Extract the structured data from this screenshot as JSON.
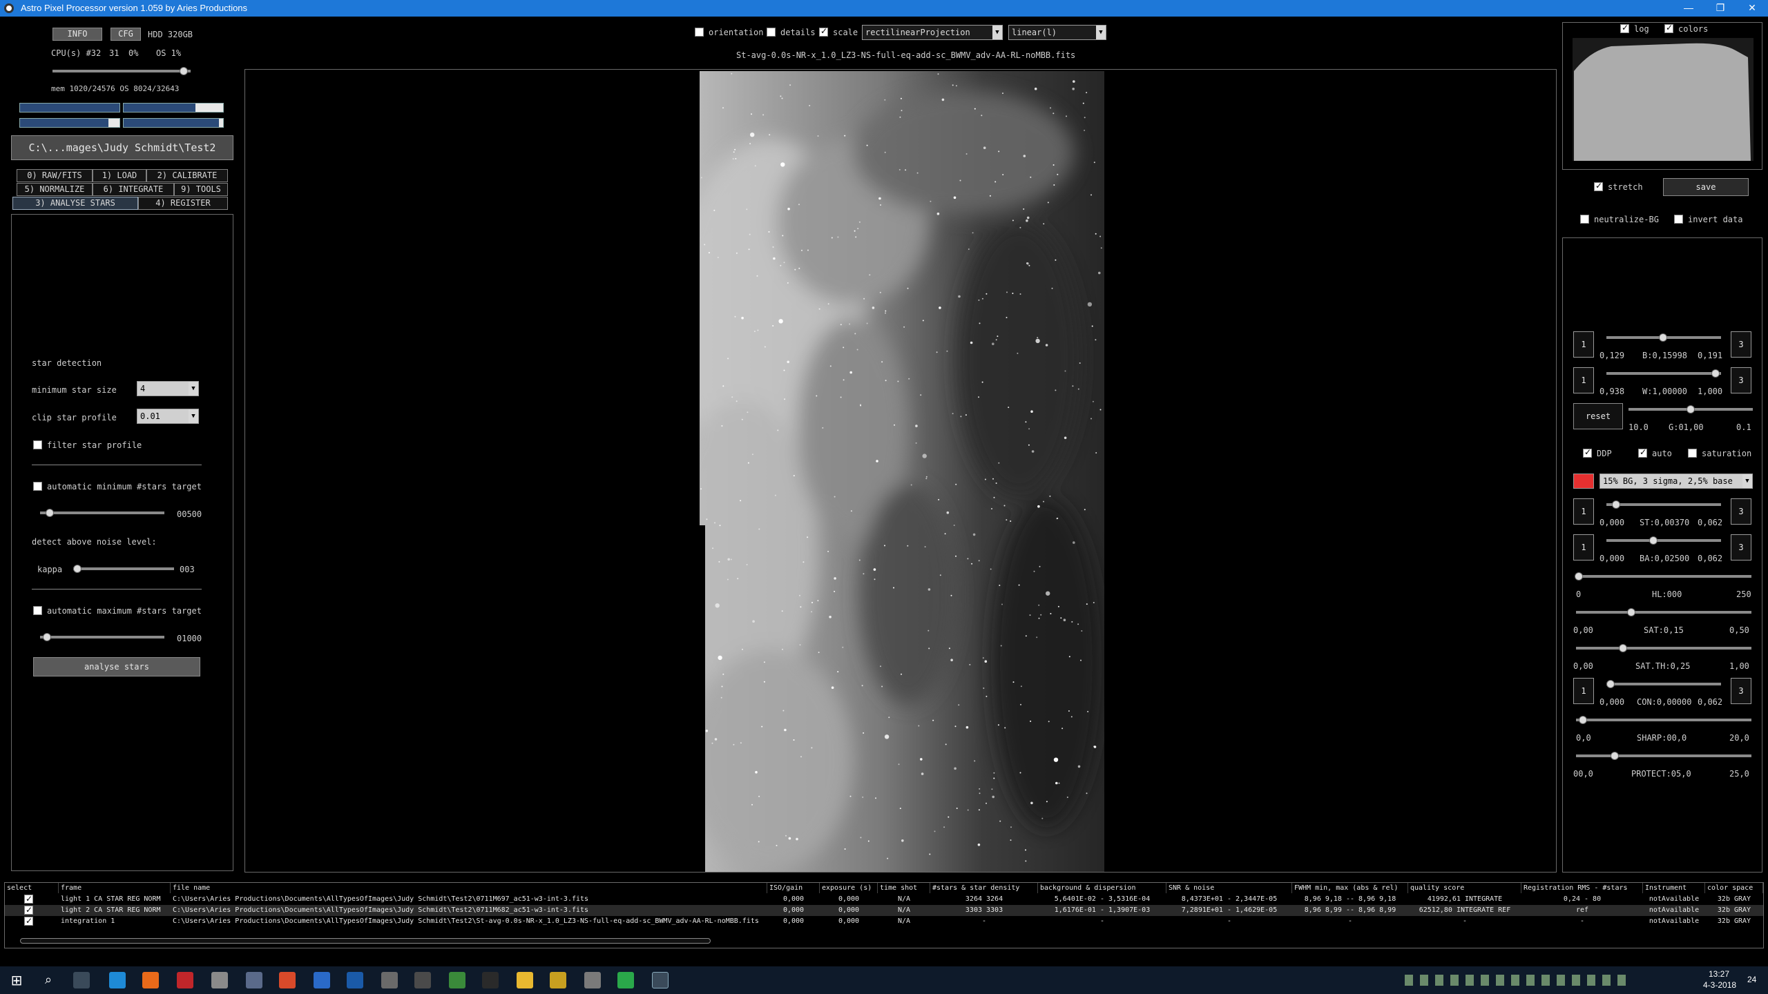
{
  "window": {
    "title": "Astro Pixel Processor version 1.059 by Aries Productions",
    "min": "—",
    "max": "❐",
    "close": "✕"
  },
  "left": {
    "info_btn": "INFO",
    "cfg_btn": "CFG",
    "hdd": "HDD 320GB",
    "cpu_label": "CPU(s) #32",
    "cpu_val1": "31",
    "cpu_val2": "0%",
    "os_pct": "OS 1%",
    "mem": "mem 1020/24576  OS 8024/32643",
    "path": "C:\\...mages\\Judy Schmidt\\Test2",
    "tabs": [
      "0) RAW/FITS",
      "1) LOAD",
      "2) CALIBRATE",
      "5) NORMALIZE",
      "6) INTEGRATE",
      "9) TOOLS",
      "3) ANALYSE STARS",
      "4) REGISTER"
    ],
    "star_detection": "star detection",
    "min_star_size_label": "minimum star size",
    "min_star_size_val": "4",
    "clip_star_label": "clip star profile",
    "clip_star_val": "0.01",
    "filter_star_label": "filter star profile",
    "auto_min_label": "automatic minimum #stars target",
    "auto_min_val": "00500",
    "detect_noise_label": "detect above noise level:",
    "kappa_label": "kappa",
    "kappa_val": "003",
    "auto_max_label": "automatic maximum #stars target",
    "auto_max_val": "01000",
    "analyse_btn": "analyse stars"
  },
  "top": {
    "orientation": "orientation",
    "details": "details",
    "scale": "scale",
    "projection": "rectilinearProjection",
    "stretch_mode": "linear(l)",
    "filename": "St-avg-0.0s-NR-x_1.0_LZ3-NS-full-eq-add-sc_BWMV_adv-AA-RL-noMBB.fits"
  },
  "right": {
    "log": "log",
    "colors": "colors",
    "stretch": "stretch",
    "save": "save",
    "neutralize": "neutralize-BG",
    "invert": "invert data",
    "b_min": "0,129",
    "b_label": "B:0,15998",
    "b_max": "0,191",
    "w_min": "0,938",
    "w_label": "W:1,00000",
    "w_max": "1,000",
    "reset": "reset",
    "g_min": "10.0",
    "g_label": "G:01,00",
    "g_max": "0.1",
    "ddp": "DDP",
    "auto": "auto",
    "saturation": "saturation",
    "preset": "15% BG, 3 sigma, 2,5% base",
    "st_min": "0,000",
    "st_label": "ST:0,00370",
    "st_max": "0,062",
    "ba_min": "0,000",
    "ba_label": "BA:0,02500",
    "ba_max": "0,062",
    "hl_min": "0",
    "hl_label": "HL:000",
    "hl_max": "250",
    "sat_min": "0,00",
    "sat_label": "SAT:0,15",
    "sat_max": "0,50",
    "satth_min": "0,00",
    "satth_label": "SAT.TH:0,25",
    "satth_max": "1,00",
    "con_min": "0,000",
    "con_label": "CON:0,00000",
    "con_max": "0,062",
    "sharp_min": "0,0",
    "sharp_label": "SHARP:00,0",
    "sharp_max": "20,0",
    "prot_min": "00,0",
    "prot_label": "PROTECT:05,0",
    "prot_max": "25,0",
    "btn1": "1",
    "btn3": "3"
  },
  "table": {
    "headers": [
      "select",
      "frame",
      "file name",
      "ISO/gain",
      "exposure (s)",
      "time shot",
      "#stars & star density",
      "background & dispersion",
      "SNR & noise",
      "FWHM min, max (abs & rel)",
      "quality score",
      "Registration RMS - #stars",
      "Instrument",
      "color space"
    ],
    "rows": [
      [
        "",
        "light 1 CA STAR REG NORM",
        "C:\\Users\\Aries Productions\\Documents\\AllTypesOfImages\\Judy Schmidt\\Test2\\0711M697_ac51-w3-int-3.fits",
        "0,000",
        "0,000",
        "N/A",
        "3264 3264",
        "5,6401E-02 - 3,5316E-04",
        "8,4373E+01 - 2,3447E-05",
        "8,96 9,18 -- 8,96 9,18",
        "41992,61 INTEGRATE",
        "0,24 - 80",
        "notAvailable",
        "32b GRAY"
      ],
      [
        "",
        "light 2 CA STAR REG NORM",
        "C:\\Users\\Aries Productions\\Documents\\AllTypesOfImages\\Judy Schmidt\\Test2\\0711M682_ac51-w3-int-3.fits",
        "0,000",
        "0,000",
        "N/A",
        "3303 3303",
        "1,6176E-01 - 1,3907E-03",
        "7,2891E+01 - 1,4629E-05",
        "8,96 8,99 -- 8,96 8,99",
        "62512,80 INTEGRATE REF",
        "ref",
        "notAvailable",
        "32b GRAY"
      ],
      [
        "",
        "integration 1",
        "C:\\Users\\Aries Productions\\Documents\\AllTypesOfImages\\Judy Schmidt\\Test2\\St-avg-0.0s-NR-x_1.0_LZ3-NS-full-eq-add-sc_BWMV_adv-AA-RL-noMBB.fits",
        "0,000",
        "0,000",
        "N/A",
        "-",
        "-",
        "-",
        "-",
        "-",
        "-",
        "notAvailable",
        "32b GRAY"
      ]
    ]
  },
  "taskbar": {
    "time": "13:27",
    "date": "4-3-2018",
    "notif": "24"
  }
}
